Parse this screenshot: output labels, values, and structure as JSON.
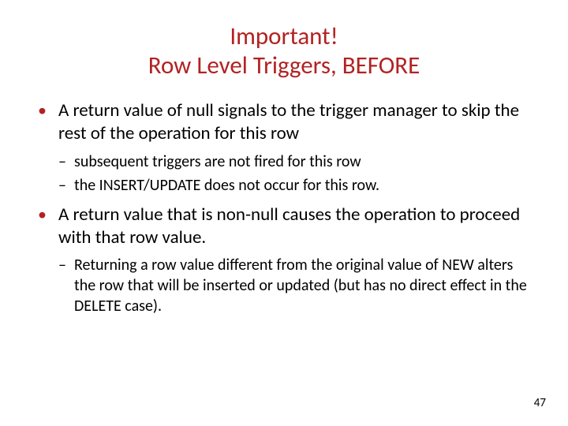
{
  "title": {
    "line1": "Important!",
    "line2": "Row Level Triggers, BEFORE"
  },
  "bullets": [
    {
      "text": "A return value of null signals to the trigger manager to skip the rest of the operation for this row",
      "subs": [
        "subsequent triggers are not fired for this row",
        "the INSERT/UPDATE does not occur for this row."
      ]
    },
    {
      "text": "A return value that is non-null causes the operation to proceed with that row value.",
      "subs": [
        "Returning a row value different from the original value of NEW alters the row that will be inserted or updated (but has no direct effect in the DELETE case)."
      ]
    }
  ],
  "pageNumber": "47"
}
